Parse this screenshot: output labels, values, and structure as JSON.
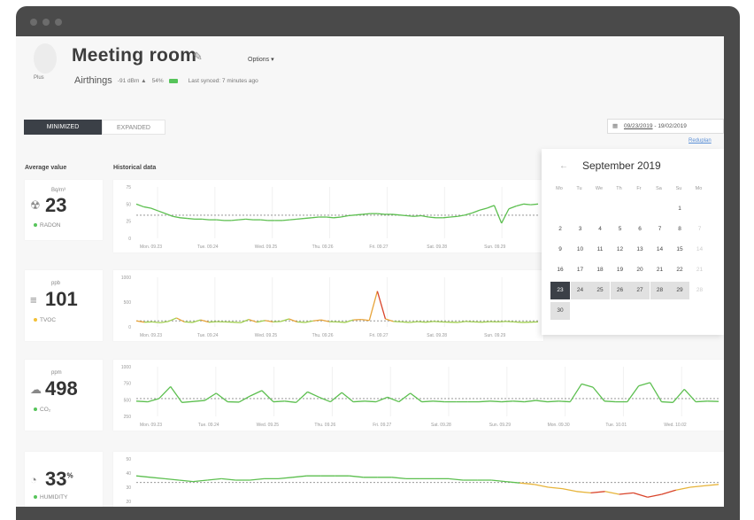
{
  "room": {
    "title": "Meeting room",
    "options_label": "Options ▾",
    "avatar_label": "Plus",
    "brand": "Airthings",
    "signal": "-91 dBm ▲",
    "battery": "54%",
    "last_synced": "Last synced: 7 minutes ago"
  },
  "view_tabs": {
    "minimized": "MINIMIZED",
    "expanded": "EXPANDED"
  },
  "date_range": {
    "from": "09/23/2019",
    "separator": "-",
    "to": "19/02/2019",
    "reset": "Reduplan"
  },
  "columns": {
    "average": "Average value",
    "historical": "Historical data"
  },
  "sensors": [
    {
      "name": "RADON",
      "value": "23",
      "unit": "Bq/m³",
      "icon": "radon-icon",
      "status_color": "#56c45a",
      "y_ticks": [
        "75",
        "50",
        "25",
        "0"
      ],
      "x_ticks": [
        "Mon. 09.23",
        "Tue. 09.24",
        "Wed. 09.25",
        "Thu. 09.26",
        "Fri. 09.27",
        "Sat. 09.28",
        "Sun. 09.29"
      ],
      "values": [
        50,
        46,
        44,
        40,
        36,
        32,
        30,
        29,
        28,
        28,
        27,
        27,
        26,
        26,
        27,
        28,
        27,
        27,
        26,
        26,
        26,
        27,
        28,
        29,
        30,
        31,
        31,
        30,
        31,
        33,
        34,
        35,
        36,
        36,
        35,
        35,
        34,
        33,
        32,
        33,
        31,
        30,
        30,
        31,
        32,
        34,
        37,
        41,
        44,
        48,
        22,
        43,
        47,
        50,
        49,
        50
      ],
      "ylim": [
        0,
        75
      ]
    },
    {
      "name": "TVOC",
      "value": "101",
      "unit": "ppb",
      "icon": "tvoc-icon",
      "status_color": "#f2c037",
      "y_ticks": [
        "1000",
        "500",
        "0"
      ],
      "x_ticks": [
        "Mon. 09.23",
        "Tue. 09.24",
        "Wed. 09.25",
        "Thu. 09.26",
        "Fri. 09.27",
        "Sat. 09.28",
        "Sun. 09.29"
      ],
      "values": [
        120,
        95,
        100,
        85,
        110,
        180,
        100,
        90,
        140,
        95,
        105,
        100,
        95,
        85,
        150,
        95,
        130,
        100,
        110,
        160,
        100,
        90,
        120,
        140,
        105,
        100,
        90,
        140,
        150,
        130,
        720,
        160,
        110,
        100,
        90,
        105,
        95,
        110,
        100,
        95,
        90,
        110,
        100,
        95,
        105,
        100,
        110,
        100,
        90,
        95,
        100
      ],
      "ylim": [
        0,
        1000
      ]
    },
    {
      "name": "CO₂",
      "value": "498",
      "unit": "ppm",
      "icon": "co2-icon",
      "status_color": "#56c45a",
      "y_ticks": [
        "1000",
        "750",
        "500",
        "250"
      ],
      "x_ticks": [
        "Mon. 09.23",
        "Tue. 09.24",
        "Wed. 09.25",
        "Thu. 09.26",
        "Fri. 09.27",
        "Sat. 09.28",
        "Sun. 09.29",
        "Mon. 09.30",
        "Tue. 10.01",
        "Wed. 10.02"
      ],
      "values": [
        480,
        470,
        520,
        700,
        460,
        475,
        490,
        600,
        470,
        465,
        560,
        640,
        470,
        480,
        460,
        620,
        540,
        470,
        610,
        470,
        480,
        470,
        540,
        470,
        600,
        470,
        480,
        470,
        470,
        470,
        470,
        480,
        470,
        480,
        470,
        490,
        470,
        480,
        470,
        740,
        690,
        480,
        470,
        470,
        710,
        760,
        470,
        460,
        660,
        470,
        480,
        475
      ],
      "ylim": [
        250,
        1000
      ]
    },
    {
      "name": "HUMIDITY",
      "value": "33",
      "unit": "%",
      "icon": "humidity-icon",
      "status_color": "#56c45a",
      "y_ticks": [
        "50",
        "40",
        "30",
        "20"
      ],
      "x_ticks": [],
      "values": [
        38,
        37,
        36,
        35,
        34,
        35,
        36,
        35,
        35,
        36,
        36,
        37,
        38,
        38,
        38,
        38,
        37,
        37,
        37,
        36,
        36,
        36,
        36,
        35,
        35,
        35,
        34,
        33,
        32,
        30,
        29,
        27,
        26,
        27,
        25,
        26,
        23,
        25,
        28,
        30,
        31,
        32
      ],
      "ylim": [
        20,
        50
      ]
    }
  ],
  "calendar": {
    "month": "September 2019",
    "weekdays": [
      "Mo",
      "Tu",
      "We",
      "Th",
      "Fr",
      "Sa",
      "Su",
      "Mo"
    ],
    "rows": [
      [
        "",
        "",
        "",
        "",
        "",
        "",
        "1",
        ""
      ],
      [
        "2",
        "3",
        "4",
        "5",
        "6",
        "7",
        "8",
        "7"
      ],
      [
        "9",
        "10",
        "11",
        "12",
        "13",
        "14",
        "15",
        "14"
      ],
      [
        "16",
        "17",
        "18",
        "19",
        "20",
        "21",
        "22",
        "21"
      ],
      [
        "23",
        "24",
        "25",
        "26",
        "27",
        "28",
        "29",
        "28"
      ],
      [
        "30",
        "",
        "",
        "",
        "",
        "",
        "",
        ""
      ]
    ]
  }
}
